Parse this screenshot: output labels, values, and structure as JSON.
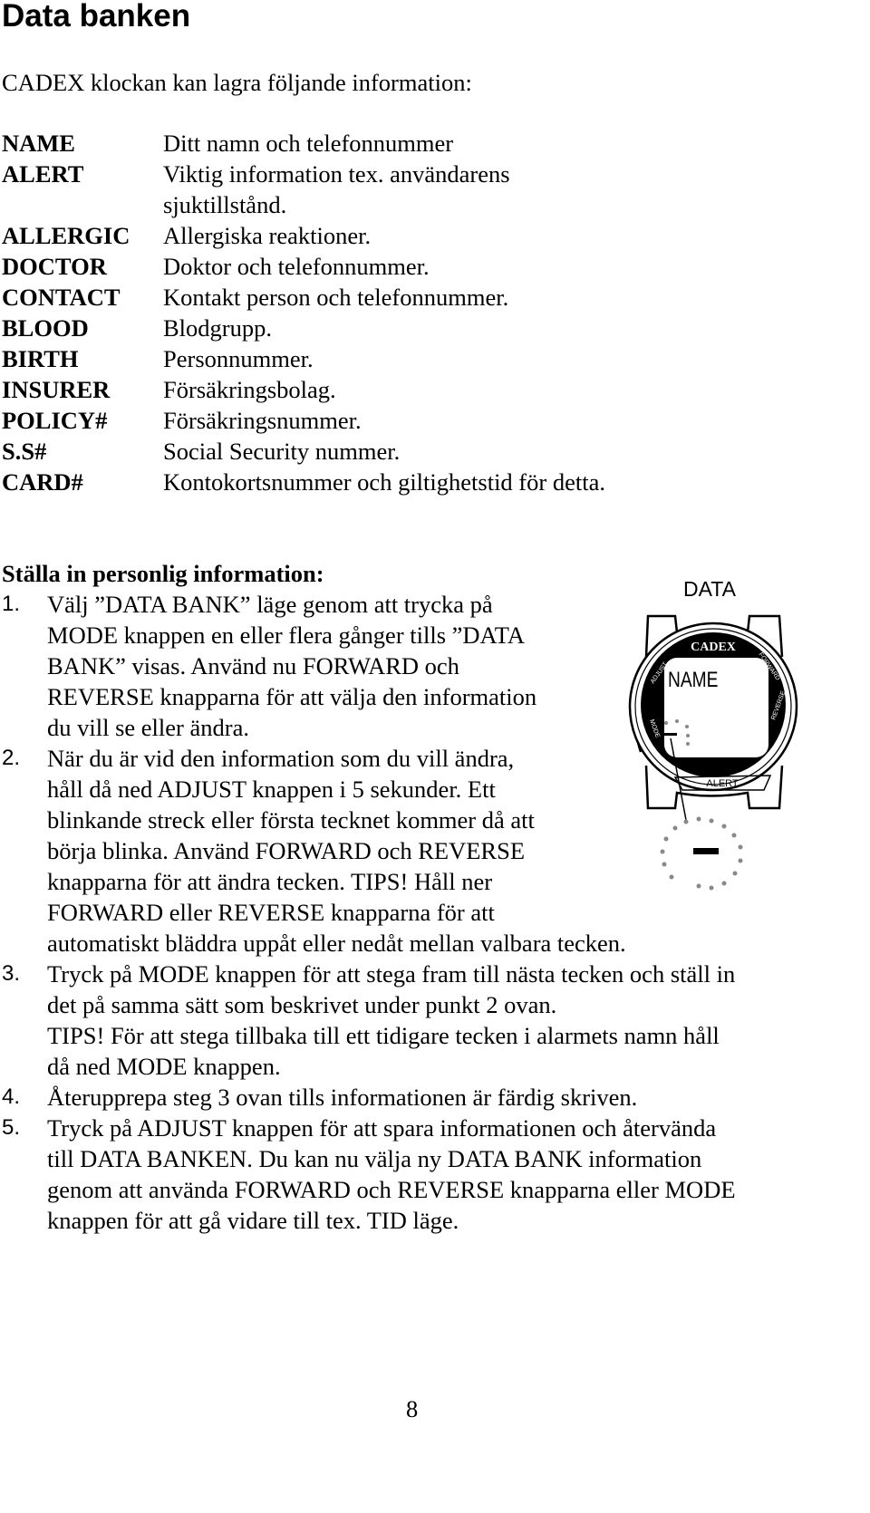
{
  "title": "Data banken",
  "intro": "CADEX klockan kan lagra följande information:",
  "definitions": [
    {
      "term": "NAME",
      "desc": [
        "Ditt namn och telefonnummer"
      ]
    },
    {
      "term": "ALERT",
      "desc": [
        "Viktig information tex. användarens",
        "sjuktillstånd."
      ]
    },
    {
      "term": "ALLERGIC",
      "desc": [
        "Allergiska reaktioner."
      ]
    },
    {
      "term": "DOCTOR",
      "desc": [
        "Doktor och telefonnummer."
      ]
    },
    {
      "term": "CONTACT",
      "desc": [
        "Kontakt person och telefonnummer."
      ]
    },
    {
      "term": "BLOOD",
      "desc": [
        "Blodgrupp."
      ]
    },
    {
      "term": "BIRTH",
      "desc": [
        "Personnummer."
      ]
    },
    {
      "term": "INSURER",
      "desc": [
        "Försäkringsbolag."
      ]
    },
    {
      "term": "POLICY#",
      "desc": [
        "Försäkringsnummer."
      ]
    },
    {
      "term": "S.S#",
      "desc": [
        "Social Security nummer."
      ]
    },
    {
      "term": "CARD#",
      "desc": [
        "Kontokortsnummer och giltighetstid för detta."
      ]
    }
  ],
  "section_heading": "Ställa in personlig information:",
  "steps": [
    {
      "num": "1.",
      "lines": [
        "Välj ”DATA BANK” läge genom att trycka på",
        "MODE knappen en eller flera gånger tills ”DATA",
        "BANK” visas. Använd nu FORWARD och",
        "REVERSE knapparna för att välja den information",
        "du vill se eller ändra."
      ]
    },
    {
      "num": "2.",
      "lines": [
        "När du är vid den information som du vill ändra,",
        "håll då ned ADJUST knappen i 5 sekunder. Ett",
        "blinkande streck eller första tecknet kommer då att",
        "börja blinka. Använd FORWARD och REVERSE",
        "knapparna för att ändra tecken. TIPS! Håll ner",
        "FORWARD eller REVERSE knapparna för att",
        "automatiskt bläddra uppåt eller nedåt mellan valbara tecken."
      ]
    },
    {
      "num": "3.",
      "lines": [
        "Tryck på MODE knappen för att stega fram till nästa tecken och ställ in",
        "det på samma sätt som beskrivet under punkt 2 ovan.",
        "TIPS! För att stega tillbaka till ett tidigare tecken i alarmets namn håll",
        "då ned MODE knappen."
      ]
    },
    {
      "num": "4.",
      "lines": [
        "Återupprepa steg 3 ovan tills informationen är färdig skriven."
      ]
    },
    {
      "num": "5.",
      "lines": [
        "Tryck på ADJUST knappen för att spara informationen och återvända",
        "till DATA BANKEN. Du kan nu välja ny DATA BANK information",
        "genom att använda FORWARD och REVERSE knapparna eller MODE",
        "knappen för att gå vidare till tex. TID läge."
      ]
    }
  ],
  "illustration": {
    "mode_label": "DATA",
    "brand": "CADEX",
    "display": "NAME",
    "buttons": [
      "ADJUST",
      "FORWARD",
      "MODE",
      "REVERSE"
    ],
    "bottom_label": "ALERT"
  },
  "page_number": "8"
}
